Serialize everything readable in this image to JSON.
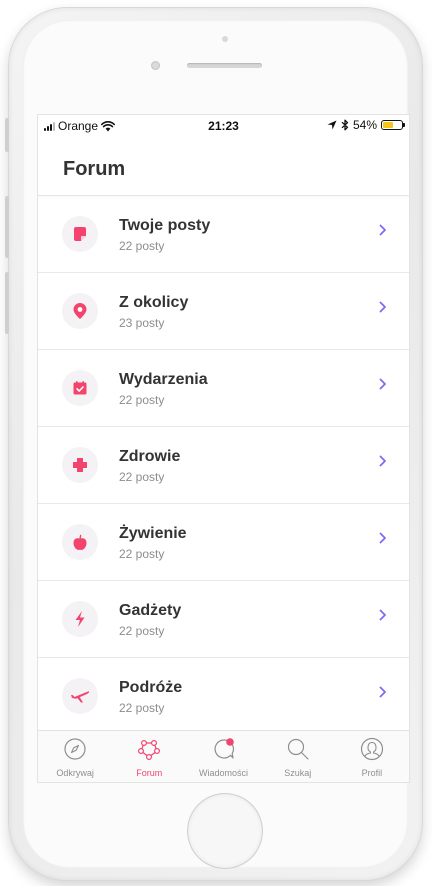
{
  "colors": {
    "accent": "#f2446e",
    "chevron": "#7b6cf6",
    "battery": "#f5c518"
  },
  "status": {
    "carrier": "Orange",
    "time": "21:23",
    "battery": "54%",
    "battery_level": 0.54
  },
  "header": {
    "title": "Forum"
  },
  "forums": [
    {
      "title": "Twoje posty",
      "count": "22 posty",
      "icon": "note-icon"
    },
    {
      "title": "Z okolicy",
      "count": "23 posty",
      "icon": "location-pin-icon"
    },
    {
      "title": "Wydarzenia",
      "count": "22 posty",
      "icon": "calendar-check-icon"
    },
    {
      "title": "Zdrowie",
      "count": "22 posty",
      "icon": "medical-cross-icon"
    },
    {
      "title": "Żywienie",
      "count": "22 posty",
      "icon": "apple-icon"
    },
    {
      "title": "Gadżety",
      "count": "22 posty",
      "icon": "lightning-icon"
    },
    {
      "title": "Podróże",
      "count": "22 posty",
      "icon": "airplane-icon"
    }
  ],
  "tabs": [
    {
      "label": "Odkrywaj",
      "icon": "compass-icon",
      "active": false
    },
    {
      "label": "Forum",
      "icon": "forum-network-icon",
      "active": true
    },
    {
      "label": "Wiadomości",
      "icon": "chat-bubble-icon",
      "active": false
    },
    {
      "label": "Szukaj",
      "icon": "search-icon",
      "active": false
    },
    {
      "label": "Profil",
      "icon": "profile-icon",
      "active": false
    }
  ]
}
